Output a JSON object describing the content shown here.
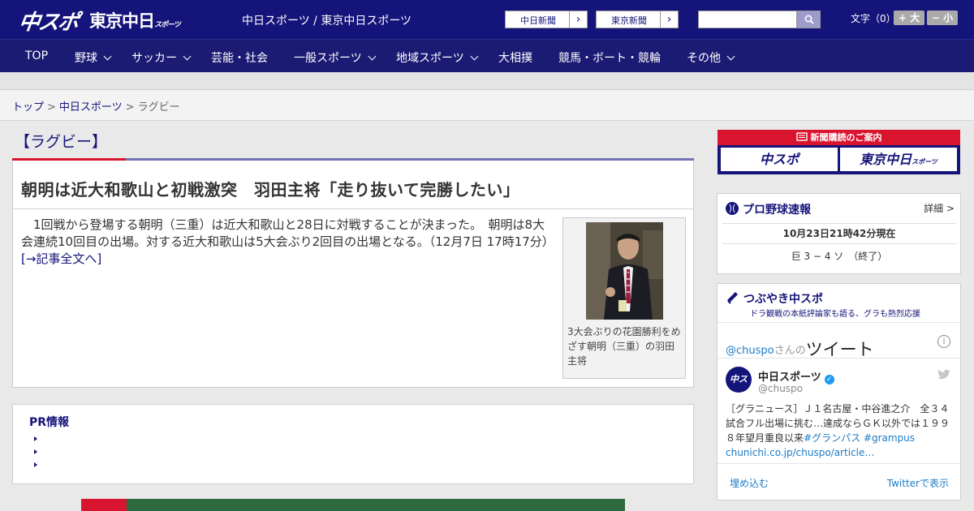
{
  "header": {
    "logo_chuspo": "中スポ",
    "logo_tokyo": "東京中日",
    "logo_tokyo_small": "スポーツ",
    "site_title": "中日スポーツ / 東京中日スポーツ",
    "ext_links": [
      {
        "label": "中日新聞",
        "arrow": "›"
      },
      {
        "label": "東京新聞",
        "arrow": "›"
      }
    ],
    "search": {
      "value": "",
      "placeholder": ""
    },
    "font_size_label": "文字（0）",
    "font_larger": "+ 大",
    "font_smaller": "− 小"
  },
  "nav": [
    {
      "label": "TOP",
      "dropdown": false
    },
    {
      "label": "野球",
      "dropdown": true
    },
    {
      "label": "サッカー",
      "dropdown": true
    },
    {
      "label": "芸能・社会",
      "dropdown": false
    },
    {
      "label": "一般スポーツ",
      "dropdown": true
    },
    {
      "label": "地域スポーツ",
      "dropdown": true
    },
    {
      "label": "大相撲",
      "dropdown": false
    },
    {
      "label": "競馬・ボート・競輪",
      "dropdown": false
    },
    {
      "label": "その他",
      "dropdown": true
    }
  ],
  "breadcrumb": {
    "home": "トップ",
    "sep1": ">",
    "section": "中日スポーツ",
    "sep2": ">",
    "current": "ラグビー"
  },
  "category_title": "【ラグビー】",
  "article": {
    "headline": "朝明は近大和歌山と初戦激突　羽田主将「走り抜いて完勝したい」",
    "lead": "　1回戦から登場する朝明（三重）は近大和歌山と28日に対戦することが決まった。　朝明は8大会連続10回目の出場。対する近大和歌山は5大会ぶり2回目の出場となる。（12月7日 17時17分）　",
    "more_link": "[→記事全文へ]",
    "photo_caption": "3大会ぶりの花園勝利をめざす朝明（三重）の羽田主将"
  },
  "pr": {
    "title": "PR情報",
    "items": [
      "",
      "",
      ""
    ]
  },
  "sidebar": {
    "subscribe": {
      "title": "新聞購読のご案内",
      "btn_chuspo": "中スポ",
      "btn_tokyo": "東京中日",
      "btn_tokyo_small": "スポーツ"
    },
    "baseball": {
      "title": "プロ野球速報",
      "detail": "詳細 >",
      "time": "10月23日21時42分現在",
      "score": "巨 3 − 4 ソ　（終了）"
    },
    "tsubuyaki": {
      "title": "つぶやき中スポ",
      "subtitle": "ドラ観戦の本紙評論家も語る、グラも熱烈応援",
      "handle_at": "@chuspo",
      "handle_san": "さんの",
      "tweets_label": "ツイート",
      "info": "i",
      "avatar_text": "中スポ",
      "account_name": "中日スポーツ",
      "account_id": "@chuspo",
      "tweet_text": "［グラニュース］Ｊ１名古屋・中谷進之介　全３４試合フル出場に挑む…達成ならＧＫ以外では１９９８年望月重良以来",
      "tweet_tag1": "#グランパス",
      "tweet_tag2": "#grampus",
      "tweet_link": "chunichi.co.jp/chuspo/article…",
      "embed": "埋め込む",
      "view_on_twitter": "Twitterで表示"
    }
  },
  "colors": {
    "navy": "#15147a",
    "nav_bg": "#1c1b74",
    "accent_red": "#d9142e",
    "twitter_blue": "#1b7bc7"
  }
}
